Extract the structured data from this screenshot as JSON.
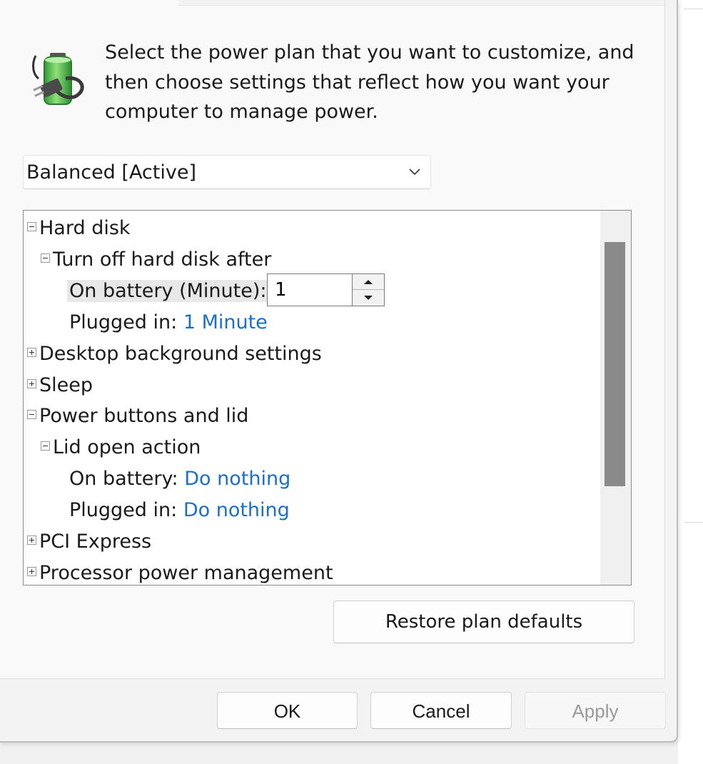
{
  "intro_text": "Select the power plan that you want to customize, and then choose settings that reflect how you want your computer to manage power.",
  "plan_selector": {
    "value": "Balanced [Active]"
  },
  "tree": {
    "hard_disk": {
      "label": "Hard disk",
      "expanded": true,
      "turn_off": {
        "label": "Turn off hard disk after",
        "on_battery_label": "On battery (Minute):",
        "on_battery_value": "1",
        "plugged_in_label": "Plugged in:",
        "plugged_in_value": "1 Minute"
      }
    },
    "desktop_background": {
      "label": "Desktop background settings",
      "expanded": false
    },
    "sleep": {
      "label": "Sleep",
      "expanded": false
    },
    "power_buttons": {
      "label": "Power buttons and lid",
      "expanded": true,
      "lid_open": {
        "label": "Lid open action",
        "on_battery_label": "On battery:",
        "on_battery_value": "Do nothing",
        "plugged_in_label": "Plugged in:",
        "plugged_in_value": "Do nothing"
      }
    },
    "pci_express": {
      "label": "PCI Express",
      "expanded": false
    },
    "processor": {
      "label": "Processor power management",
      "expanded": false
    }
  },
  "buttons": {
    "restore": "Restore plan defaults",
    "ok": "OK",
    "cancel": "Cancel",
    "apply": "Apply"
  },
  "colors": {
    "link": "#1a6fc9",
    "battery_green": "#3cb043"
  }
}
